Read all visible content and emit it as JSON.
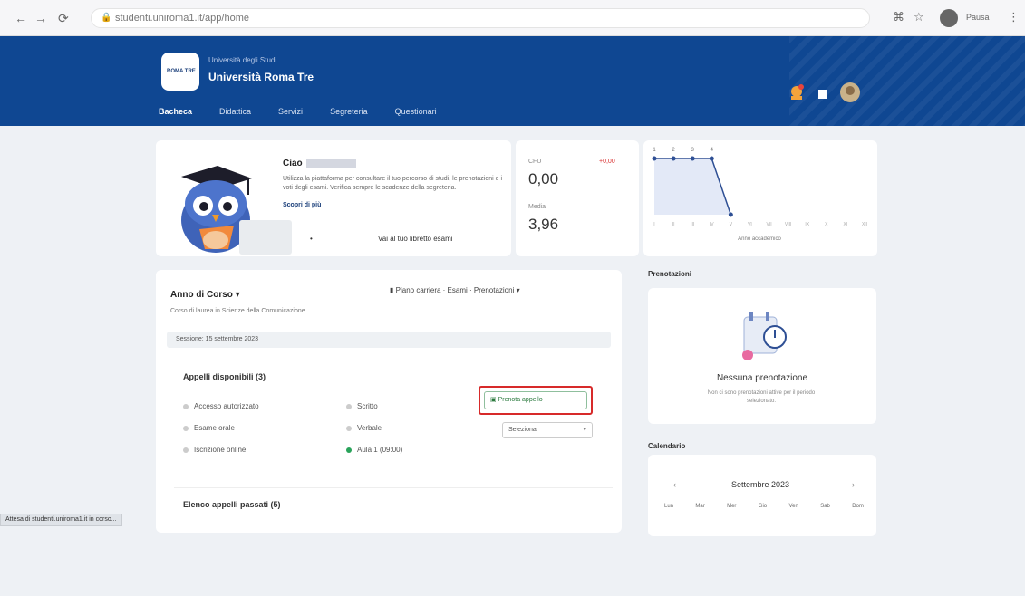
{
  "browser": {
    "url": "studenti.uniroma1.it/app/home",
    "back_icon": "arrow-left-icon",
    "profile_label": "Pausa"
  },
  "header": {
    "uni_subtitle": "Università degli Studi",
    "uni_name": "Università Roma Tre",
    "logo_text": "ROMA TRE",
    "nav": [
      "Bacheca",
      "Didattica",
      "Servizi",
      "Segreteria",
      "Questionari"
    ]
  },
  "welcome": {
    "greeting": "Ciao",
    "text": "Utilizza la piattaforma per consultare il tuo percorso di studi, le prenotazioni e i voti degli esami. Verifica sempre le scadenze della segreteria.",
    "link": "Scopri di più",
    "action_dot": "•",
    "action_label": "Vai al tuo libretto esami"
  },
  "stats": {
    "label_1": "CFU",
    "value_1": "0,00",
    "badge": "+0,00",
    "label_2": "Media",
    "value_2": "3,96"
  },
  "chart_data": {
    "type": "line",
    "title": "",
    "xlabel": "Anno accademico",
    "ylabel": "",
    "categories": [
      "I",
      "II",
      "III",
      "IV",
      "V",
      "VI",
      "VII",
      "VIII",
      "IX",
      "X",
      "XI",
      "XII"
    ],
    "series": [
      {
        "values": [
          30,
          30,
          30,
          30,
          0
        ]
      }
    ],
    "point_labels": [
      "1",
      "2",
      "3",
      "4"
    ],
    "ylim": [
      0,
      30
    ],
    "grid": false
  },
  "main": {
    "course_title": "Anno di Corso",
    "course_sub": "Corso di laurea in Scienze della Comunicazione",
    "top_link": "Piano carriera · Esami · Prenotazioni",
    "date_bar": "Sessione: 15 settembre 2023",
    "sections": [
      {
        "title": "Appelli disponibili (3)",
        "options": [
          "Accesso autorizzato",
          "Scritto",
          "Esame orale",
          "Verbale",
          "Iscrizione online"
        ],
        "confirmed": "Aula 1 (09:00)",
        "button": "Prenota appello",
        "select": "Seleziona"
      },
      {
        "title": "Elenco appelli passati (5)"
      }
    ]
  },
  "right": {
    "title": "Prenotazioni",
    "card_title": "Nessuna prenotazione",
    "card_desc": "Non ci sono prenotazioni attive per il periodo selezionato.",
    "cal_title": "Calendario",
    "cal_month": "Settembre 2023",
    "cal_prev": "‹",
    "cal_next": "›",
    "cal_days": [
      "Lun",
      "Mar",
      "Mer",
      "Gio",
      "Ven",
      "Sab",
      "Dom"
    ]
  },
  "status_bar": "Attesa di studenti.uniroma1.it in corso..."
}
